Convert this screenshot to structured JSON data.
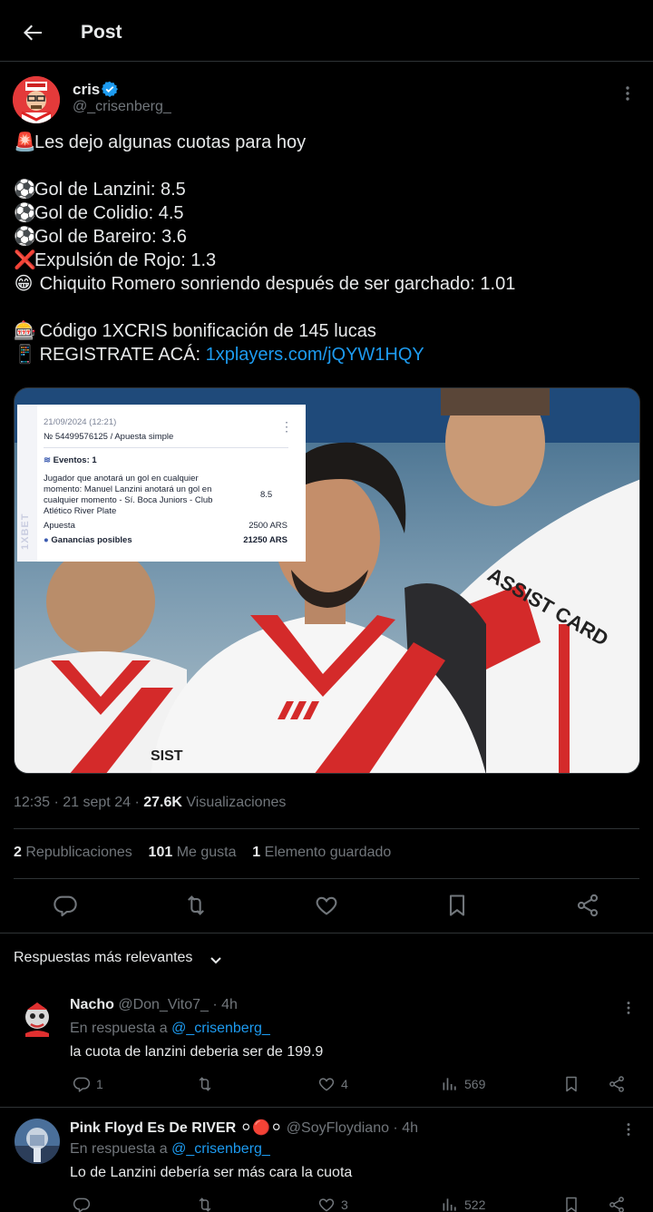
{
  "header": {
    "title": "Post"
  },
  "post": {
    "author_name": "cris",
    "author_handle": "@_crisenberg_",
    "lines": [
      {
        "emoji": "🚨",
        "text": "Les dejo algunas cuotas para hoy"
      },
      {
        "emoji": "",
        "text": ""
      },
      {
        "emoji": "⚽",
        "text": "Gol de Lanzini: 8.5"
      },
      {
        "emoji": "⚽",
        "text": "Gol de Colidio: 4.5"
      },
      {
        "emoji": "⚽",
        "text": "Gol de Bareiro: 3.6"
      },
      {
        "emoji": "❌",
        "text": "Expulsión de Rojo: 1.3"
      },
      {
        "emoji": "😁",
        "text": "Chiquito Romero sonriendo después de ser garchado: 1.01"
      },
      {
        "emoji": "",
        "text": ""
      },
      {
        "emoji": "🎰",
        "text": "Código 1XCRIS bonificación de 145 lucas"
      },
      {
        "emoji": "📱",
        "text": "REGISTRATE ACÁ:"
      }
    ],
    "link_text": "1xplayers.com/jQYW1HQY",
    "ticket": {
      "date": "21/09/2024 (12:21)",
      "number": "№ 54499576125 / Apuesta simple",
      "events_label": "Eventos: 1",
      "event_desc_1": "Jugador que anotará un gol en cualquier",
      "event_desc_2": "momento: Manuel Lanzini anotará un gol en",
      "event_desc_3": "cualquier momento - Sí. Boca Juniors - Club",
      "event_desc_4": "Atlético River Plate",
      "odds": "8.5",
      "stake_label": "Apuesta",
      "stake_value": "2500 ARS",
      "winnings_label": "Ganancias posibles",
      "winnings_value": "21250 ARS",
      "side_brand": "1XBET"
    },
    "time": "12:35",
    "date": "21 sept 24",
    "views_count": "27.6K",
    "views_label": "Visualizaciones",
    "reposts_count": "2",
    "reposts_label": "Republicaciones",
    "likes_count": "101",
    "likes_label": "Me gusta",
    "bookmarks_count": "1",
    "bookmarks_label": "Elemento guardado"
  },
  "sort_label": "Respuestas más relevantes",
  "replies": [
    {
      "name": "Nacho",
      "handle": "@Don_Vito7_",
      "time": "4h",
      "in_reply_label": "En respuesta a",
      "in_reply_handle": "@_crisenberg_",
      "text": "la cuota de lanzini deberia ser de 199.9",
      "replies": "1",
      "reposts": "",
      "likes": "4",
      "views": "569"
    },
    {
      "name": "Pink Floyd Es De RIVER",
      "name_emoji": "⚪🔴⚪",
      "handle": "@SoyFloydiano",
      "time": "4h",
      "in_reply_label": "En respuesta a",
      "in_reply_handle": "@_crisenberg_",
      "text": "Lo de Lanzini debería ser más cara la cuota",
      "replies": "",
      "reposts": "",
      "likes": "3",
      "views": "522"
    }
  ],
  "colors": {
    "accent": "#1d9bf0",
    "muted": "#71767b",
    "text": "#e7e9ea",
    "border": "#2f3336"
  }
}
